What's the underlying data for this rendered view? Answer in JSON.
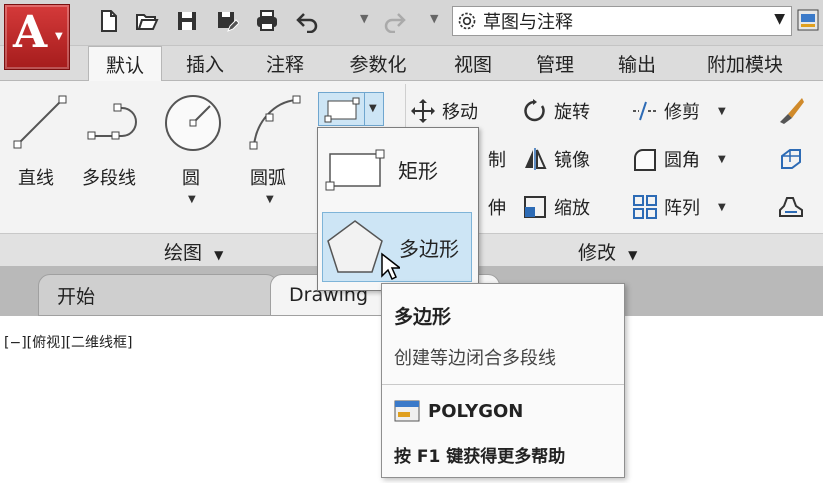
{
  "quick_access": {
    "icons": [
      "new-icon",
      "open-icon",
      "save-icon",
      "save-as-icon",
      "print-icon",
      "undo-icon",
      "redo-icon"
    ],
    "workspace": "草图与注释"
  },
  "ribbon_tabs": [
    "默认",
    "插入",
    "注释",
    "参数化",
    "视图",
    "管理",
    "输出",
    "附加模块"
  ],
  "draw_panel": {
    "title": "绘图",
    "buttons": [
      "直线",
      "多段线",
      "圆",
      "圆弧"
    ]
  },
  "modify_panel": {
    "title": "修改",
    "tools": [
      "移动",
      "旋转",
      "修剪",
      "制",
      "镜像",
      "圆角",
      "伸",
      "缩放",
      "阵列"
    ]
  },
  "rect_dropdown": {
    "items": [
      "矩形",
      "多边形"
    ]
  },
  "doc_tabs": [
    "开始",
    "Drawing"
  ],
  "viewport_label": "[−][俯视][二维线框]",
  "tooltip": {
    "title": "多边形",
    "description": "创建等边闭合多段线",
    "command": "POLYGON",
    "help": "按 F1 键获得更多帮助"
  },
  "colors": {
    "logo_red": "#c62828",
    "highlight": "#cde5f5",
    "ribbon_bg": "#f3f3f3"
  }
}
